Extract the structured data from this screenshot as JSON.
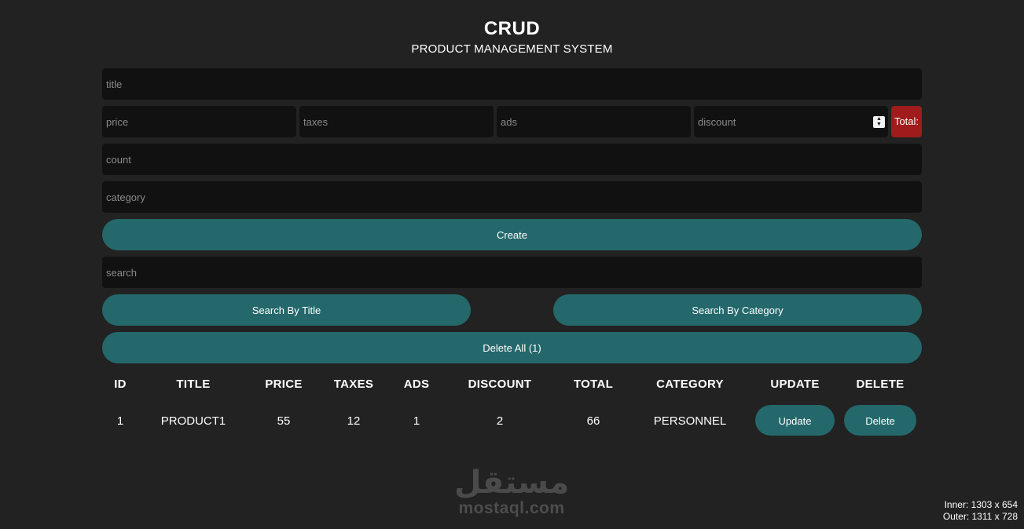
{
  "header": {
    "title": "CRUD",
    "subtitle": "PRODUCT MANAGEMENT SYSTEM"
  },
  "form": {
    "title_placeholder": "title",
    "price_placeholder": "price",
    "taxes_placeholder": "taxes",
    "ads_placeholder": "ads",
    "discount_placeholder": "discount",
    "total_label": "Total:",
    "count_placeholder": "count",
    "category_placeholder": "category",
    "create_label": "Create"
  },
  "search": {
    "placeholder": "search",
    "by_title_label": "Search By Title",
    "by_category_label": "Search By Category"
  },
  "delete_all_label": "Delete All (1)",
  "table": {
    "headers": [
      "ID",
      "TITLE",
      "PRICE",
      "TAXES",
      "ADS",
      "DISCOUNT",
      "TOTAL",
      "CATEGORY",
      "UPDATE",
      "DELETE"
    ],
    "rows": [
      {
        "id": "1",
        "title": "PRODUCT1",
        "price": "55",
        "taxes": "12",
        "ads": "1",
        "discount": "2",
        "total": "66",
        "category": "PERSONNEL",
        "update_label": "Update",
        "delete_label": "Delete"
      }
    ]
  },
  "watermark": {
    "text": "mostaql.com",
    "logo_text": "مستقل"
  },
  "viewport_info": {
    "inner": "Inner: 1303 x 654",
    "outer": "Outer: 1311 x 728"
  },
  "colors": {
    "background": "#222222",
    "input_bg": "#111111",
    "accent_teal": "#24686b",
    "total_red": "#a01b1b"
  }
}
